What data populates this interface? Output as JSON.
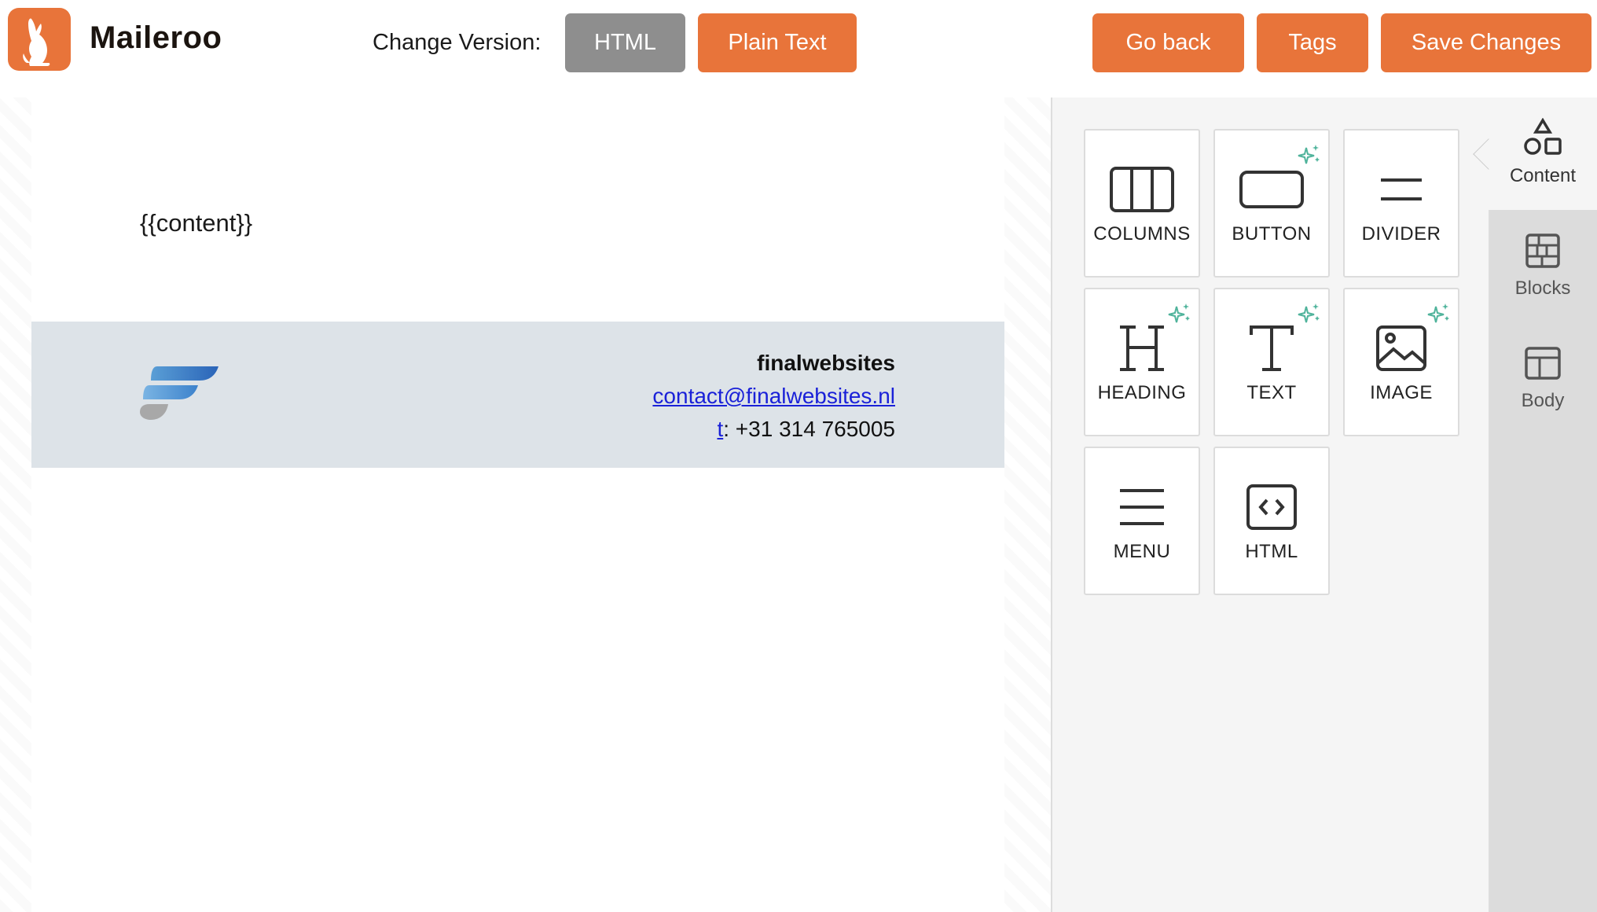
{
  "header": {
    "brand_name": "Maileroo",
    "change_version_label": "Change Version:",
    "buttons": {
      "html": "HTML",
      "plain_text": "Plain Text",
      "go_back": "Go back",
      "tags": "Tags",
      "save_changes": "Save Changes"
    },
    "accent_color": "#e8743a",
    "inactive_color": "#8e8e8e"
  },
  "email": {
    "placeholder": "{{content}}",
    "footer": {
      "company": "finalwebsites",
      "email": "contact@finalwebsites.nl",
      "phone_prefix": "t",
      "phone": ": +31 314 765005",
      "background_color": "#dde3e8"
    }
  },
  "panel": {
    "tiles": [
      {
        "label": "COLUMNS",
        "icon": "columns-icon",
        "sparkle": false
      },
      {
        "label": "BUTTON",
        "icon": "button-icon",
        "sparkle": true
      },
      {
        "label": "DIVIDER",
        "icon": "divider-icon",
        "sparkle": false
      },
      {
        "label": "HEADING",
        "icon": "heading-icon",
        "sparkle": true
      },
      {
        "label": "TEXT",
        "icon": "text-icon",
        "sparkle": true
      },
      {
        "label": "IMAGE",
        "icon": "image-icon",
        "sparkle": true
      },
      {
        "label": "MENU",
        "icon": "menu-icon",
        "sparkle": false
      },
      {
        "label": "HTML",
        "icon": "code-icon",
        "sparkle": false
      }
    ]
  },
  "sidetabs": [
    {
      "label": "Content",
      "icon": "shapes-icon",
      "active": true
    },
    {
      "label": "Blocks",
      "icon": "blocks-icon",
      "active": false
    },
    {
      "label": "Body",
      "icon": "layout-icon",
      "active": false
    }
  ]
}
